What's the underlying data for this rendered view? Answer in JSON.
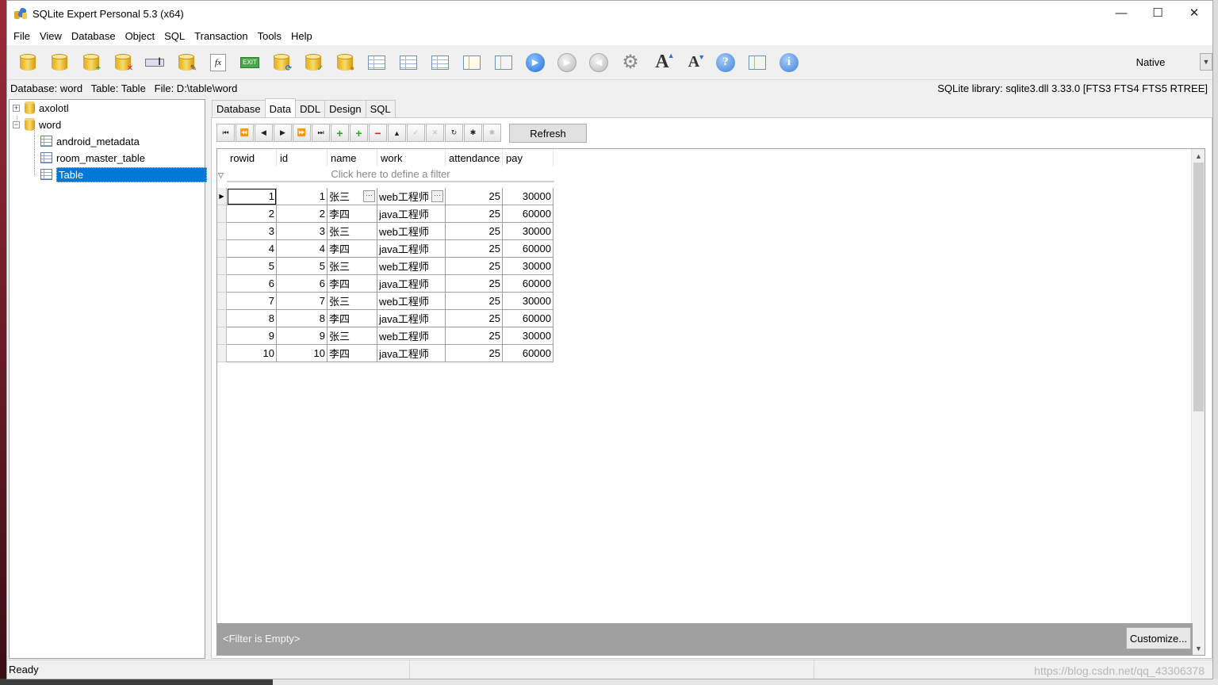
{
  "window": {
    "title": "SQLite Expert Personal 5.3 (x64)",
    "controls": {
      "minimize": "—",
      "maximize": "☐",
      "close": "✕"
    }
  },
  "menu": [
    "File",
    "View",
    "Database",
    "Object",
    "SQL",
    "Transaction",
    "Tools",
    "Help"
  ],
  "toolbar": {
    "icons": [
      "new-database-icon",
      "open-database-icon",
      "attach-database-icon",
      "detach-database-icon",
      "rename-icon",
      "vacuum-icon",
      "function-icon",
      "exit-icon",
      "export-icon",
      "check-database-icon",
      "encrypt-icon",
      "query-builder-icon",
      "new-table-icon",
      "drop-table-icon",
      "new-view-icon",
      "sql-editor-icon",
      "run-icon",
      "step-icon",
      "stop-icon",
      "settings-icon",
      "increase-font-icon",
      "decrease-font-icon",
      "help-icon",
      "export-data-icon",
      "info-icon"
    ],
    "mode_select": "Native",
    "exit_text": "EXIT",
    "fx_text": "fx"
  },
  "infobar": {
    "left": "Database: word   Table: Table   File: D:\\table\\word",
    "right": "SQLite library: sqlite3.dll 3.33.0 [FTS3 FTS4 FTS5 RTREE]"
  },
  "tree": {
    "databases": [
      {
        "name": "axolotl",
        "expanded": false
      },
      {
        "name": "word",
        "expanded": true,
        "tables": [
          "android_metadata",
          "room_master_table",
          "Table"
        ],
        "selected": "Table"
      }
    ]
  },
  "tabs": [
    "Database",
    "Data",
    "DDL",
    "Design",
    "SQL"
  ],
  "active_tab": "Data",
  "data_nav": {
    "refresh_label": "Refresh"
  },
  "grid": {
    "columns": [
      "rowid",
      "id",
      "name",
      "work",
      "attendance",
      "pay"
    ],
    "filter_placeholder": "Click here to define a filter",
    "rows": [
      [
        "1",
        "1",
        "张三",
        "web工程师",
        "25",
        "30000"
      ],
      [
        "2",
        "2",
        "李四",
        "java工程师",
        "25",
        "60000"
      ],
      [
        "3",
        "3",
        "张三",
        "web工程师",
        "25",
        "30000"
      ],
      [
        "4",
        "4",
        "李四",
        "java工程师",
        "25",
        "60000"
      ],
      [
        "5",
        "5",
        "张三",
        "web工程师",
        "25",
        "30000"
      ],
      [
        "6",
        "6",
        "李四",
        "java工程师",
        "25",
        "60000"
      ],
      [
        "7",
        "7",
        "张三",
        "web工程师",
        "25",
        "30000"
      ],
      [
        "8",
        "8",
        "李四",
        "java工程师",
        "25",
        "60000"
      ],
      [
        "9",
        "9",
        "张三",
        "web工程师",
        "25",
        "30000"
      ],
      [
        "10",
        "10",
        "李四",
        "java工程师",
        "25",
        "60000"
      ]
    ],
    "filter_status": "<Filter is Empty>",
    "customize_label": "Customize..."
  },
  "status": {
    "text": "Ready",
    "watermark": "https://blog.csdn.net/qq_43306378"
  },
  "colors": {
    "selection": "#0078d7",
    "filterbar": "#a0a0a0"
  }
}
